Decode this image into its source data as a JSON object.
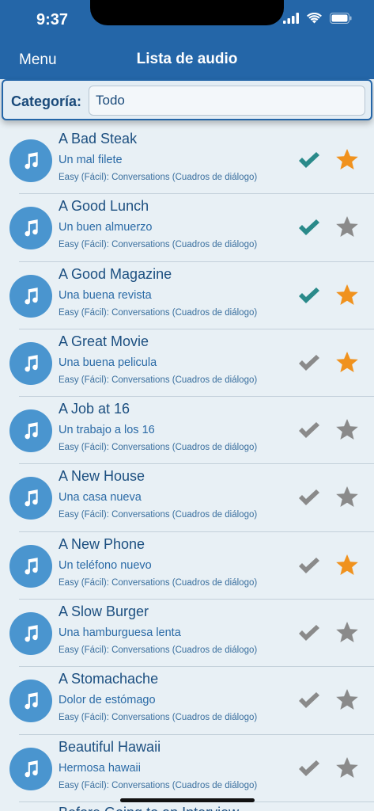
{
  "status": {
    "time": "9:37"
  },
  "nav": {
    "menu_label": "Menu",
    "title": "Lista de audio"
  },
  "filter": {
    "label": "Categoría:",
    "value": "Todo"
  },
  "colors": {
    "header": "#2466a8",
    "accent_check": "#2a8a8a",
    "inactive": "#8a8a8a",
    "star_active": "#f0921e"
  },
  "items": [
    {
      "title": "A Bad Steak",
      "subtitle": "Un mal filete",
      "level": "Easy (Fácil): Conversations (Cuadros de diálogo)",
      "completed": true,
      "favorite": true
    },
    {
      "title": "A Good Lunch",
      "subtitle": "Un buen almuerzo",
      "level": "Easy (Fácil): Conversations (Cuadros de diálogo)",
      "completed": true,
      "favorite": false
    },
    {
      "title": "A Good Magazine",
      "subtitle": "Una buena revista",
      "level": "Easy (Fácil): Conversations (Cuadros de diálogo)",
      "completed": true,
      "favorite": true
    },
    {
      "title": "A Great Movie",
      "subtitle": "Una buena pelicula",
      "level": "Easy (Fácil): Conversations (Cuadros de diálogo)",
      "completed": false,
      "favorite": true
    },
    {
      "title": "A Job at 16",
      "subtitle": "Un trabajo a los 16",
      "level": "Easy (Fácil): Conversations (Cuadros de diálogo)",
      "completed": false,
      "favorite": false
    },
    {
      "title": "A New House",
      "subtitle": "Una casa nueva",
      "level": "Easy (Fácil): Conversations (Cuadros de diálogo)",
      "completed": false,
      "favorite": false
    },
    {
      "title": "A New Phone",
      "subtitle": "Un teléfono nuevo",
      "level": "Easy (Fácil): Conversations (Cuadros de diálogo)",
      "completed": false,
      "favorite": true
    },
    {
      "title": "A Slow Burger",
      "subtitle": "Una hamburguesa lenta",
      "level": "Easy (Fácil): Conversations (Cuadros de diálogo)",
      "completed": false,
      "favorite": false
    },
    {
      "title": "A Stomachache",
      "subtitle": "Dolor de estómago",
      "level": "Easy (Fácil): Conversations (Cuadros de diálogo)",
      "completed": false,
      "favorite": false
    },
    {
      "title": "Beautiful Hawaii",
      "subtitle": "Hermosa hawaii",
      "level": "Easy (Fácil): Conversations (Cuadros de diálogo)",
      "completed": false,
      "favorite": false
    }
  ],
  "next_item_partial_title": "Before Going to an Interview"
}
